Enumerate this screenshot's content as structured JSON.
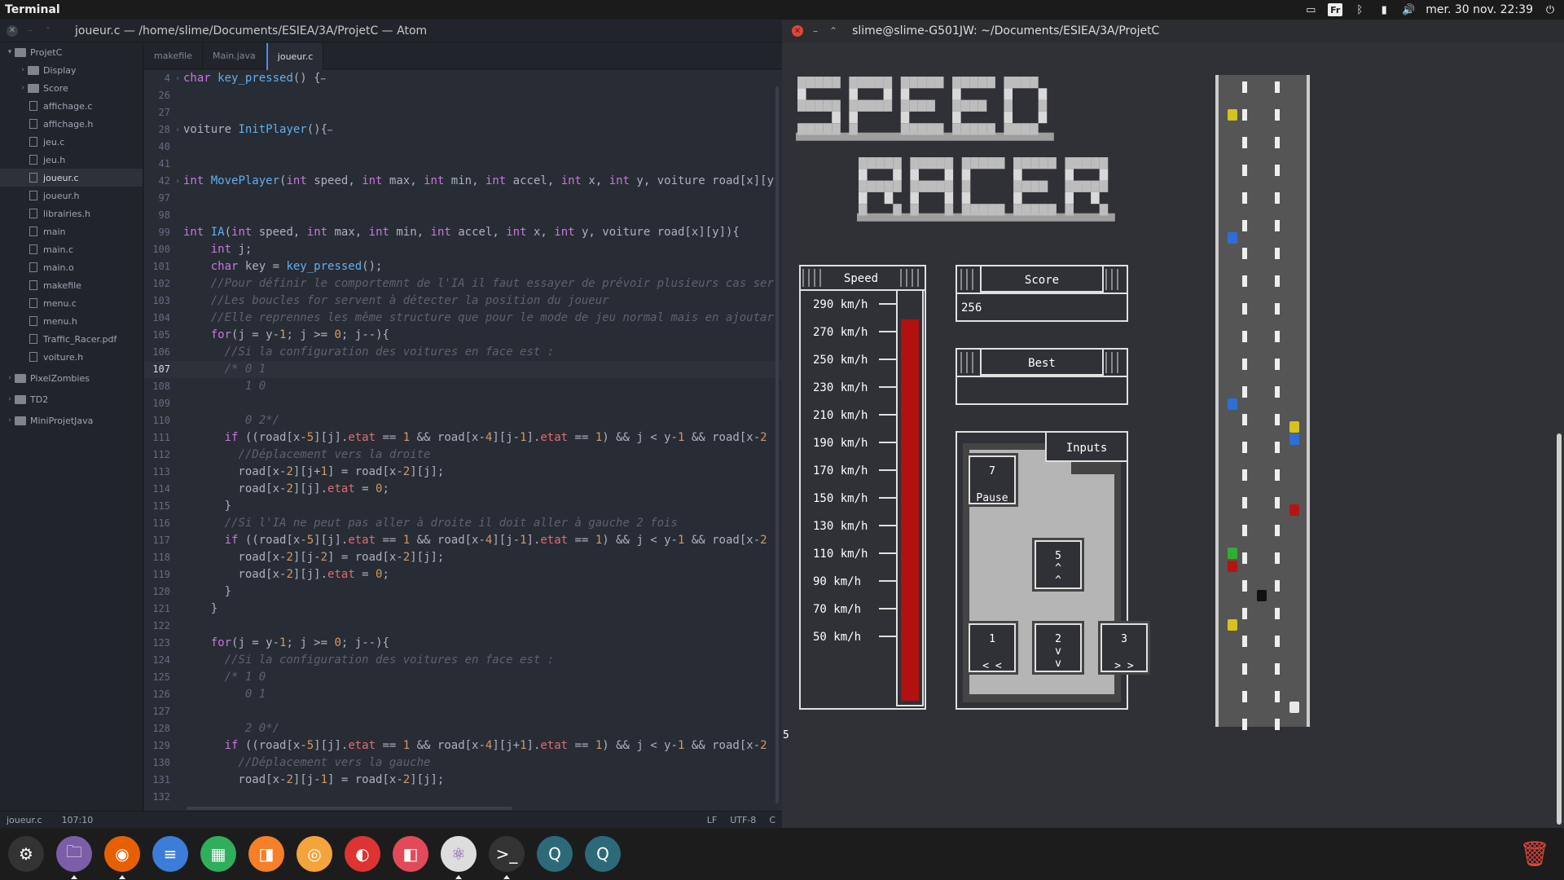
{
  "topbar": {
    "app_name": "Terminal",
    "keyboard_layout": "Fr",
    "clock": "mer. 30 nov. 22:39"
  },
  "atom": {
    "title": "joueur.c — /home/slime/Documents/ESIEA/3A/ProjetC — Atom",
    "tree": [
      {
        "label": "ProjetC",
        "type": "folder",
        "open": true,
        "depth": 0
      },
      {
        "label": "Display",
        "type": "folder",
        "open": false,
        "depth": 1
      },
      {
        "label": "Score",
        "type": "folder",
        "open": false,
        "depth": 1
      },
      {
        "label": "affichage.c",
        "type": "file",
        "depth": 1
      },
      {
        "label": "affichage.h",
        "type": "file",
        "depth": 1
      },
      {
        "label": "jeu.c",
        "type": "file",
        "depth": 1
      },
      {
        "label": "jeu.h",
        "type": "file",
        "depth": 1
      },
      {
        "label": "joueur.c",
        "type": "file",
        "depth": 1,
        "selected": true
      },
      {
        "label": "joueur.h",
        "type": "file",
        "depth": 1
      },
      {
        "label": "librairies.h",
        "type": "file",
        "depth": 1
      },
      {
        "label": "main",
        "type": "file",
        "depth": 1
      },
      {
        "label": "main.c",
        "type": "file",
        "depth": 1
      },
      {
        "label": "main.o",
        "type": "file",
        "depth": 1
      },
      {
        "label": "makefile",
        "type": "file",
        "depth": 1
      },
      {
        "label": "menu.c",
        "type": "file",
        "depth": 1
      },
      {
        "label": "menu.h",
        "type": "file",
        "depth": 1
      },
      {
        "label": "Traffic_Racer.pdf",
        "type": "file",
        "depth": 1
      },
      {
        "label": "voiture.h",
        "type": "file",
        "depth": 1
      },
      {
        "label": "PixelZombies",
        "type": "folder",
        "open": false,
        "depth": 0
      },
      {
        "label": "TD2",
        "type": "folder",
        "open": false,
        "depth": 0
      },
      {
        "label": "MiniProjetJava",
        "type": "folder",
        "open": false,
        "depth": 0
      }
    ],
    "tabs": [
      "makefile",
      "Main.java",
      "joueur.c"
    ],
    "active_tab": 2,
    "status": {
      "file": "joueur.c",
      "cursor": "107:10",
      "eol": "LF",
      "encoding": "UTF-8",
      "grammar": "C"
    }
  },
  "code_lines": [
    {
      "n": "4",
      "fold": "›",
      "html": "<span class='kw'>char</span> <span class='fn'>key_pressed</span>() {<span class='fold-mk'>⋯</span>"
    },
    {
      "n": "26",
      "html": ""
    },
    {
      "n": "27",
      "html": ""
    },
    {
      "n": "28",
      "fold": "›",
      "html": "voiture <span class='fn'>InitPlayer</span>(){<span class='fold-mk'>⋯</span>"
    },
    {
      "n": "40",
      "html": ""
    },
    {
      "n": "41",
      "html": ""
    },
    {
      "n": "42",
      "fold": "›",
      "html": "<span class='kw'>int</span> <span class='fn'>MovePlayer</span>(<span class='kw'>int</span> speed, <span class='kw'>int</span> max, <span class='kw'>int</span> min, <span class='kw'>int</span> accel, <span class='kw'>int</span> x, <span class='kw'>int</span> y, voiture road[x][y"
    },
    {
      "n": "97",
      "html": ""
    },
    {
      "n": "98",
      "html": ""
    },
    {
      "n": "99",
      "html": "<span class='kw'>int</span> <span class='fn'>IA</span>(<span class='kw'>int</span> speed, <span class='kw'>int</span> max, <span class='kw'>int</span> min, <span class='kw'>int</span> accel, <span class='kw'>int</span> x, <span class='kw'>int</span> y, voiture road[x][y]){"
    },
    {
      "n": "100",
      "html": "    <span class='kw'>int</span> j;"
    },
    {
      "n": "101",
      "html": "    <span class='kw'>char</span> key = <span class='fn'>key_pressed</span>();"
    },
    {
      "n": "102",
      "html": "    <span class='cm'>//Pour définir le comportemnt de l'IA il faut essayer de prévoir plusieurs cas ser</span>"
    },
    {
      "n": "103",
      "html": "    <span class='cm'>//Les boucles for servent à détecter la position du joueur</span>"
    },
    {
      "n": "104",
      "html": "    <span class='cm'>//Elle reprennes les même structure que pour le mode de jeu normal mais en ajoutar</span>"
    },
    {
      "n": "105",
      "html": "    <span class='kw'>for</span>(j = y-<span class='nm'>1</span>; j &gt;= <span class='nm'>0</span>; j--){"
    },
    {
      "n": "106",
      "html": "      <span class='cm'>//Si la configuration des voitures en face est :</span>"
    },
    {
      "n": "107",
      "cur": true,
      "html": "      <span class='cm'>/* 0 1</span>"
    },
    {
      "n": "108",
      "html": "<span class='cm'>         1 0</span>"
    },
    {
      "n": "109",
      "html": ""
    },
    {
      "n": "110",
      "html": "<span class='cm'>         0 2*/</span>"
    },
    {
      "n": "111",
      "html": "      <span class='kw'>if</span> ((road[x-<span class='nm'>5</span>][j].<span class='pr'>etat</span> == <span class='nm'>1</span> &amp;&amp; road[x-<span class='nm'>4</span>][j-<span class='nm'>1</span>].<span class='pr'>etat</span> == <span class='nm'>1</span>) &amp;&amp; j &lt; y-<span class='nm'>1</span> &amp;&amp; road[x-<span class='nm'>2</span>"
    },
    {
      "n": "112",
      "html": "        <span class='cm'>//Déplacement vers la droite</span>"
    },
    {
      "n": "113",
      "html": "        road[x-<span class='nm'>2</span>][j+<span class='nm'>1</span>] = road[x-<span class='nm'>2</span>][j];"
    },
    {
      "n": "114",
      "html": "        road[x-<span class='nm'>2</span>][j].<span class='pr'>etat</span> = <span class='nm'>0</span>;"
    },
    {
      "n": "115",
      "html": "      }"
    },
    {
      "n": "116",
      "html": "      <span class='cm'>//Si l'IA ne peut pas aller à droite il doit aller à gauche 2 fois</span>"
    },
    {
      "n": "117",
      "html": "      <span class='kw'>if</span> ((road[x-<span class='nm'>5</span>][j].<span class='pr'>etat</span> == <span class='nm'>1</span> &amp;&amp; road[x-<span class='nm'>4</span>][j-<span class='nm'>1</span>].<span class='pr'>etat</span> == <span class='nm'>1</span>) &amp;&amp; j &lt; y-<span class='nm'>1</span> &amp;&amp; road[x-<span class='nm'>2</span>"
    },
    {
      "n": "118",
      "html": "        road[x-<span class='nm'>2</span>][j-<span class='nm'>2</span>] = road[x-<span class='nm'>2</span>][j];"
    },
    {
      "n": "119",
      "html": "        road[x-<span class='nm'>2</span>][j].<span class='pr'>etat</span> = <span class='nm'>0</span>;"
    },
    {
      "n": "120",
      "html": "      }"
    },
    {
      "n": "121",
      "html": "    }"
    },
    {
      "n": "122",
      "html": ""
    },
    {
      "n": "123",
      "html": "    <span class='kw'>for</span>(j = y-<span class='nm'>1</span>; j &gt;= <span class='nm'>0</span>; j--){"
    },
    {
      "n": "124",
      "html": "      <span class='cm'>//Si la configuration des voitures en face est :</span>"
    },
    {
      "n": "125",
      "html": "      <span class='cm'>/* 1 0</span>"
    },
    {
      "n": "126",
      "html": "<span class='cm'>         0 1</span>"
    },
    {
      "n": "127",
      "html": ""
    },
    {
      "n": "128",
      "html": "<span class='cm'>         2 0*/</span>"
    },
    {
      "n": "129",
      "html": "      <span class='kw'>if</span> ((road[x-<span class='nm'>5</span>][j].<span class='pr'>etat</span> == <span class='nm'>1</span> &amp;&amp; road[x-<span class='nm'>4</span>][j+<span class='nm'>1</span>].<span class='pr'>etat</span> == <span class='nm'>1</span>) &amp;&amp; j &lt; y-<span class='nm'>1</span> &amp;&amp; road[x-<span class='nm'>2</span>"
    },
    {
      "n": "130",
      "html": "        <span class='cm'>//Déplacement vers la gauche</span>"
    },
    {
      "n": "131",
      "html": "        road[x-<span class='nm'>2</span>][j-<span class='nm'>1</span>] = road[x-<span class='nm'>2</span>][j];"
    },
    {
      "n": "132",
      "html": ""
    }
  ],
  "terminal": {
    "title": "slime@slime-G501JW: ~/Documents/ESIEA/3A/ProjetC",
    "game": {
      "logo_line1": "SPEED",
      "logo_line2": "RACER",
      "speed_label": "Speed",
      "speed_ticks": [
        "290  km/h",
        "270  km/h",
        "250  km/h",
        "230  km/h",
        "210  km/h",
        "190  km/h",
        "170  km/h",
        "150  km/h",
        "130  km/h",
        "110  km/h",
        "90  km/h",
        "70  km/h",
        "50  km/h"
      ],
      "speed_gauge_level": 0.94,
      "score_label": "Score",
      "score_value": "256",
      "best_label": "Best",
      "best_value": "",
      "inputs_label": "Inputs",
      "keys": {
        "k7": {
          "num": "7",
          "txt": "Pause"
        },
        "k5": {
          "num": "5",
          "txt": "^\n^"
        },
        "k1": {
          "num": "1",
          "txt": "< <"
        },
        "k2": {
          "num": "2",
          "txt": "v\nv"
        },
        "k3": {
          "num": "3",
          "txt": "> >"
        }
      },
      "prompt_char": "5"
    }
  },
  "dock": [
    "system-settings-icon",
    "files-icon",
    "firefox-icon",
    "writer-icon",
    "calc-icon",
    "impress-icon",
    "photos-icon",
    "tweaks-icon",
    "software-icon",
    "atom-icon",
    "terminal-icon",
    "qtcreator-icon",
    "qtcreator2-icon"
  ],
  "trash": "trash-icon"
}
